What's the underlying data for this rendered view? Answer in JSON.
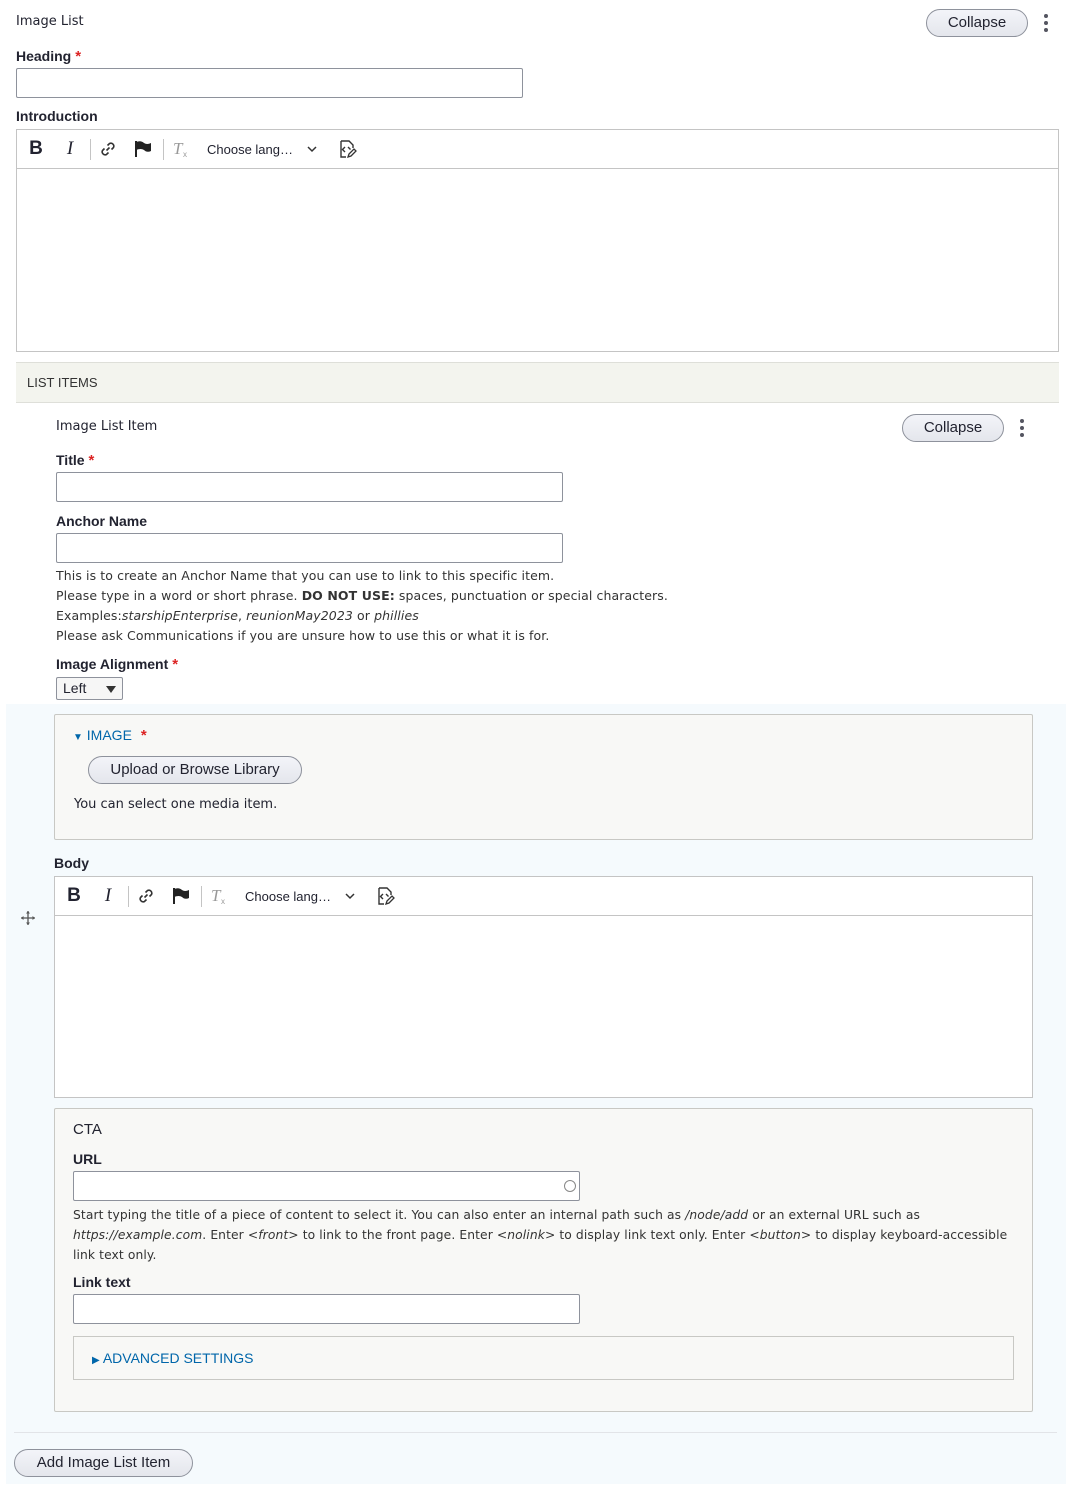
{
  "paragraph": {
    "type_label": "Image List",
    "collapse_label": "Collapse",
    "heading_label": "Heading",
    "heading_value": "",
    "introduction_label": "Introduction",
    "required_mark": "*"
  },
  "editor": {
    "bold_label": "B",
    "italic_label": "I",
    "language_select": "Choose lang…",
    "icons": [
      "bold-icon",
      "italic-icon",
      "link-icon",
      "flag-icon",
      "remove-format-icon",
      "chevron-down-icon",
      "source-editing-icon"
    ]
  },
  "list_items": {
    "section_title": "LIST ITEMS",
    "item": {
      "type_label": "Image List Item",
      "collapse_label": "Collapse",
      "title_label": "Title",
      "title_value": "",
      "anchor_label": "Anchor Name",
      "anchor_value": "",
      "anchor_help": {
        "line1": "This is to create an Anchor Name that you can use to link to this specific item.",
        "line2_pre": "Please type in a word or short phrase.",
        "line2_strong": "DO NOT USE:",
        "line2_post": "spaces, punctuation or special characters.",
        "line3_pre": "Examples:",
        "ex1": "starshipEnterprise",
        "comma": ",",
        "ex2": "reunionMay2023",
        "or": "or",
        "ex3": "phillies",
        "line4": "Please ask Communications if you are unsure how to use this or what it is for."
      },
      "alignment_label": "Image Alignment",
      "alignment_value": "Left",
      "image": {
        "summary": "IMAGE",
        "upload_button": "Upload or Browse Library",
        "help": "You can select one media item."
      },
      "body_label": "Body",
      "cta": {
        "title": "CTA",
        "url_label": "URL",
        "url_value": "",
        "url_help": {
          "p1": "Start typing the title of a piece of content to select it. You can also enter an internal path such as",
          "path": "/node/add",
          "p2": "or an external URL such as",
          "example": "https://example.com",
          "p3": ". Enter",
          "front": "<front>",
          "p4": "to link to the front page. Enter",
          "nolink": "<nolink>",
          "p5": "to display link text only. Enter",
          "button": "<button>",
          "p6": "to display keyboard-accessible link",
          "p7": "text only."
        },
        "link_text_label": "Link text",
        "link_text_value": "",
        "advanced_settings": "ADVANCED SETTINGS"
      }
    },
    "add_button": "Add Image List Item"
  },
  "colors": {
    "required": "#dc2323",
    "link": "#0066aa",
    "section_bg": "#f3f4ee",
    "item_bg": "#f5fafd",
    "details_bg": "#f8f8f6"
  }
}
